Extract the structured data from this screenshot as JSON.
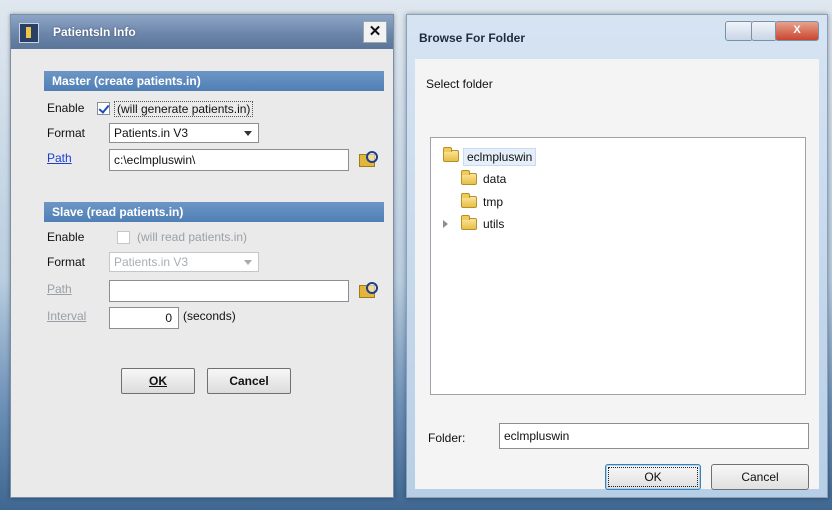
{
  "left_dialog": {
    "title": "PatientsIn Info",
    "close_glyph": "✕",
    "master": {
      "header": "Master   (create patients.in)",
      "enable_label": "Enable",
      "enable_checked": true,
      "enable_desc": "(will generate patients.in)",
      "format_label": "Format",
      "format_value": "Patients.in V3",
      "path_label": "Path",
      "path_value": "c:\\eclmpluswin\\"
    },
    "slave": {
      "header": "Slave   (read patients.in)",
      "enable_label": "Enable",
      "enable_checked": false,
      "enable_desc": "(will read patients.in)",
      "format_label": "Format",
      "format_value": "Patients.in V3",
      "path_label": "Path",
      "path_value": "",
      "interval_label": "Interval",
      "interval_value": "0",
      "interval_unit": "(seconds)"
    },
    "ok_label": "OK",
    "cancel_label": "Cancel"
  },
  "right_dialog": {
    "title": "Browse For Folder",
    "close_glyph": "X",
    "prompt": "Select folder",
    "tree": {
      "root": "eclmpluswin",
      "children": [
        "data",
        "tmp",
        "utils"
      ]
    },
    "folder_label": "Folder:",
    "folder_value": "eclmpluswin",
    "ok_label": "OK",
    "cancel_label": "Cancel"
  },
  "icons": [
    "app-icon",
    "close-icon",
    "checkbox-icon",
    "dropdown-arrow-icon",
    "browse-folder-icon",
    "folder-icon",
    "expand-arrow-icon",
    "minimize-icon",
    "maximize-icon"
  ],
  "colors": {
    "section_header": "#5a88bd",
    "link": "#1c3fd0",
    "title_bar": "#7891b4"
  }
}
